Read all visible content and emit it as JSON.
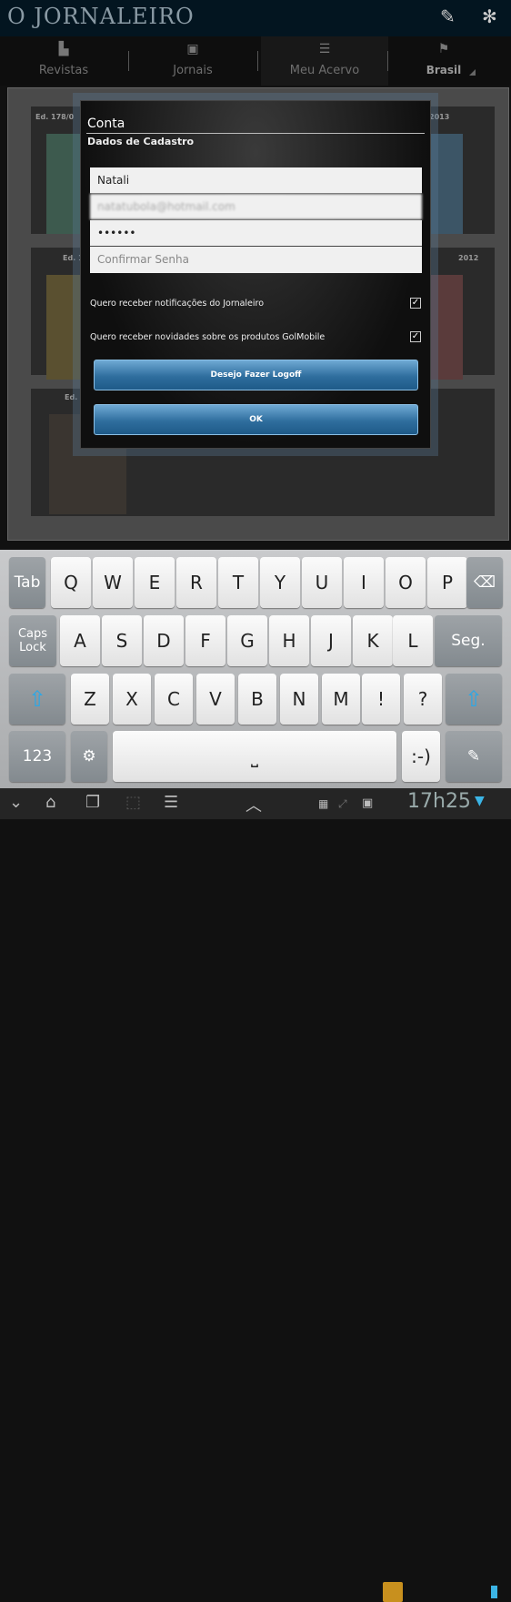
{
  "app": {
    "title": "O JORNALEIRO",
    "edit_icon": "pencil-icon",
    "settings_icon": "gear-icon"
  },
  "tabs": [
    {
      "label": "Revistas",
      "icon": "document-icon"
    },
    {
      "label": "Jornais",
      "icon": "newspaper-icon"
    },
    {
      "label": "Meu Acervo",
      "icon": "list-icon",
      "active": true
    },
    {
      "label": "Brasil",
      "icon": "flag-icon"
    }
  ],
  "background": {
    "editions": [
      "Ed. 178/0",
      "2013",
      "Ed. 16",
      "2012",
      "Ed. 0"
    ]
  },
  "dialog": {
    "title": "Conta",
    "subtitle": "Dados de Cadastro",
    "fields": {
      "name": "Natali",
      "email": "natatubola@hotmail.com",
      "password": "••••••",
      "confirm_placeholder": "Confirmar Senha"
    },
    "checkboxes": [
      {
        "label": "Quero receber notificações do Jornaleiro",
        "checked": true
      },
      {
        "label": "Quero receber novidades sobre os produtos GolMobile",
        "checked": true
      }
    ],
    "logoff_label": "Desejo Fazer Logoff",
    "ok_label": "OK"
  },
  "keyboard": {
    "row1": [
      "Tab",
      "Q",
      "W",
      "E",
      "R",
      "T",
      "Y",
      "U",
      "I",
      "O",
      "P",
      "⌫"
    ],
    "row2": [
      "Caps Lock",
      "A",
      "S",
      "D",
      "F",
      "G",
      "H",
      "J",
      "K",
      "L",
      "Seg."
    ],
    "row3": [
      "⇧",
      "Z",
      "X",
      "C",
      "V",
      "B",
      "N",
      "M",
      "!",
      "?",
      "⇧"
    ],
    "row4": [
      "123",
      "⚙",
      "␣",
      ":-)",
      "✎"
    ]
  },
  "statusbar": {
    "time": "17h25"
  },
  "colors": {
    "accent": "#2f6e9e",
    "topbar": "#031520"
  }
}
